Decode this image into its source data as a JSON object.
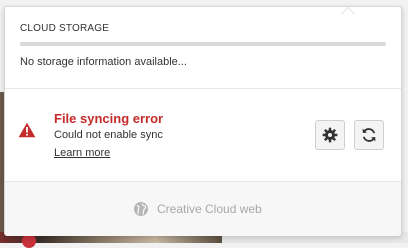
{
  "storage": {
    "label": "CLOUD STORAGE",
    "used_fraction": 0,
    "info": "No storage information available..."
  },
  "sync": {
    "title": "File syncing error",
    "subtitle": "Could not enable sync",
    "learn_more": "Learn more",
    "error_color": "#c42b2b"
  },
  "icons": {
    "warning": "warning-triangle-icon",
    "settings": "gear-icon",
    "sync": "refresh-icon",
    "web": "globe-icon"
  },
  "footer": {
    "web_label": "Creative Cloud web"
  }
}
